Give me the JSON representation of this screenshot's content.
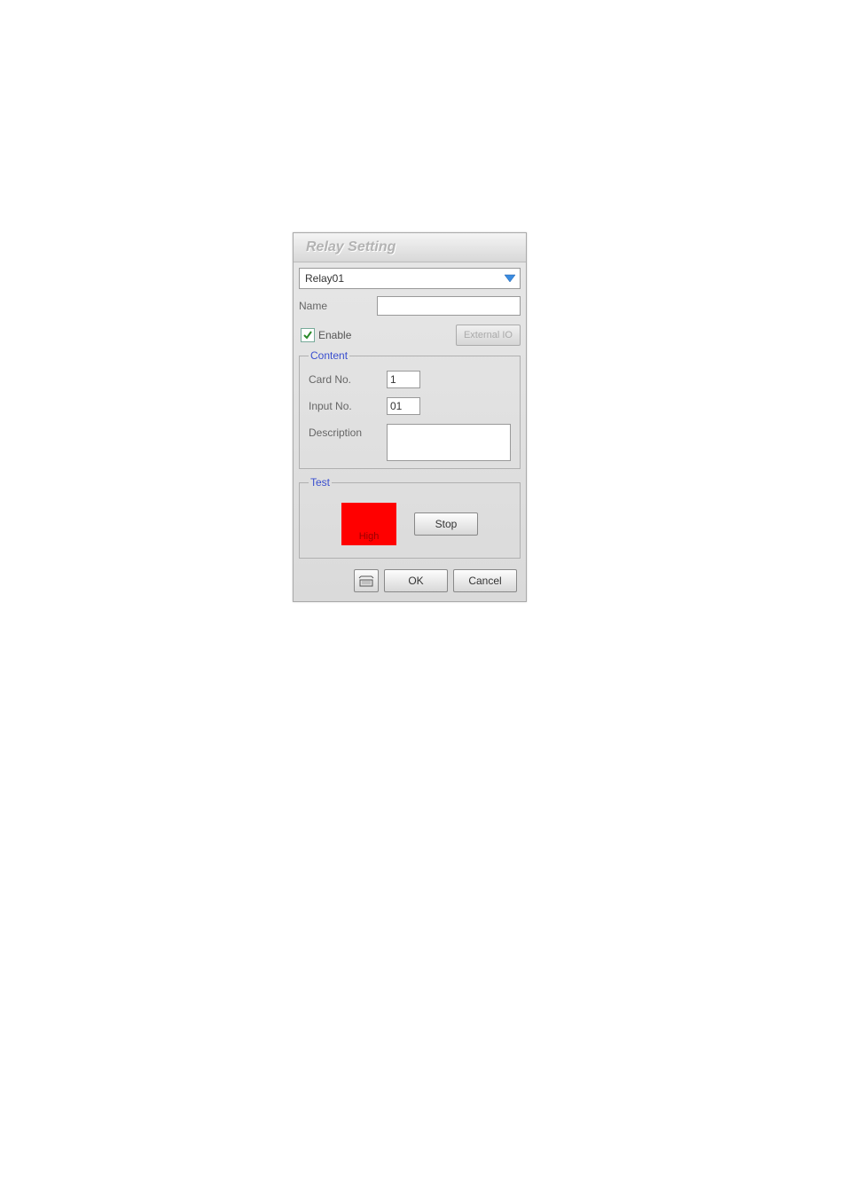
{
  "dialog": {
    "title": "Relay Setting",
    "relay_select": {
      "selected": "Relay01"
    },
    "name_label": "Name",
    "name_value": "",
    "enable_label": "Enable",
    "enable_checked": true,
    "external_io_label": "External IO",
    "content": {
      "legend": "Content",
      "card_no_label": "Card No.",
      "card_no_value": "1",
      "input_no_label": "Input No.",
      "input_no_value": "01",
      "description_label": "Description",
      "description_value": ""
    },
    "test": {
      "legend": "Test",
      "indicator_label": "High",
      "stop_label": "Stop"
    },
    "footer": {
      "ok_label": "OK",
      "cancel_label": "Cancel"
    }
  }
}
